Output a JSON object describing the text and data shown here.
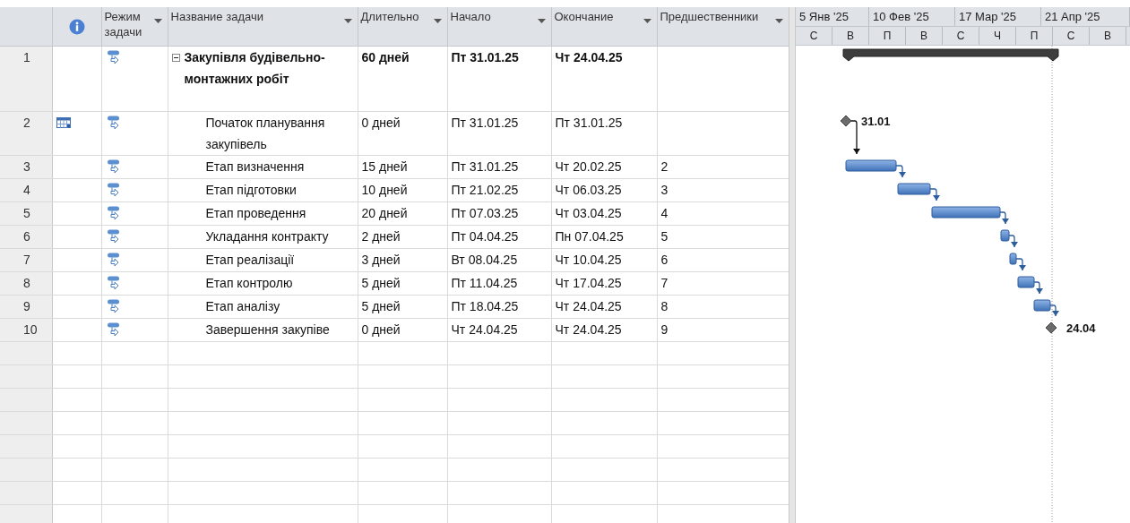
{
  "columns": [
    {
      "kind": "id"
    },
    {
      "kind": "info"
    },
    {
      "kind": "text",
      "label": "Режим задачи",
      "filter": true
    },
    {
      "kind": "text",
      "label": "Название задачи",
      "filter": true
    },
    {
      "kind": "text",
      "label": "Длительно",
      "filter": true
    },
    {
      "kind": "text",
      "label": "Начало",
      "filter": true
    },
    {
      "kind": "text",
      "label": "Окончание",
      "filter": true
    },
    {
      "kind": "text",
      "label": "Предшественники",
      "filter": true
    }
  ],
  "tasks": [
    {
      "id": "1",
      "kind": "summary",
      "auto_scheduled": true,
      "name": "Закупівля будівельно-монтажних робіт",
      "duration": "60 дней",
      "start": "Пт 31.01.25",
      "finish": "Чт 24.04.25",
      "expanded": true,
      "children": [
        {
          "id": "2",
          "kind": "milestone",
          "calendar": true,
          "auto_scheduled": true,
          "name": "Початок планування закупівель",
          "duration": "0 дней",
          "start": "Пт 31.01.25",
          "finish": "Пт 31.01.25",
          "bar_label": "31.01"
        },
        {
          "id": "3",
          "kind": "task",
          "auto_scheduled": true,
          "name": "Етап визначення",
          "duration": "15 дней",
          "start": "Пт 31.01.25",
          "finish": "Чт 20.02.25",
          "predecessors": "2"
        },
        {
          "id": "4",
          "kind": "task",
          "auto_scheduled": true,
          "name": "Етап підготовки",
          "duration": "10 дней",
          "start": "Пт 21.02.25",
          "finish": "Чт 06.03.25",
          "predecessors": "3"
        },
        {
          "id": "5",
          "kind": "task",
          "auto_scheduled": true,
          "name": "Етап проведення",
          "duration": "20 дней",
          "start": "Пт 07.03.25",
          "finish": "Чт 03.04.25",
          "predecessors": "4"
        },
        {
          "id": "6",
          "kind": "task",
          "auto_scheduled": true,
          "name": "Укладання контракту",
          "duration": "2 дней",
          "start": "Пт 04.04.25",
          "finish": "Пн 07.04.25",
          "predecessors": "5"
        },
        {
          "id": "7",
          "kind": "task",
          "auto_scheduled": true,
          "name": "Етап реалізації",
          "duration": "3 дней",
          "start": "Вт 08.04.25",
          "finish": "Чт 10.04.25",
          "predecessors": "6"
        },
        {
          "id": "8",
          "kind": "task",
          "auto_scheduled": true,
          "name": "Етап контролю",
          "duration": "5 дней",
          "start": "Пт 11.04.25",
          "finish": "Чт 17.04.25",
          "predecessors": "7"
        },
        {
          "id": "9",
          "kind": "task",
          "auto_scheduled": true,
          "name": "Етап аналізу",
          "duration": "5 дней",
          "start": "Пт 18.04.25",
          "finish": "Чт 24.04.25",
          "predecessors": "8"
        },
        {
          "id": "10",
          "kind": "milestone",
          "auto_scheduled": true,
          "name": "Завершення закупіве",
          "duration": "0 дней",
          "start": "Чт 24.04.25",
          "finish": "Чт 24.04.25",
          "predecessors": "9",
          "bar_label": "24.04"
        }
      ]
    }
  ],
  "timescale": {
    "top": [
      "5 Янв '25",
      "10 Фев '25",
      "17 Мар '25",
      "21 Апр '25"
    ],
    "bottom": [
      "С",
      "В",
      "П",
      "В",
      "С",
      "Ч",
      "П",
      "С",
      "В"
    ]
  }
}
